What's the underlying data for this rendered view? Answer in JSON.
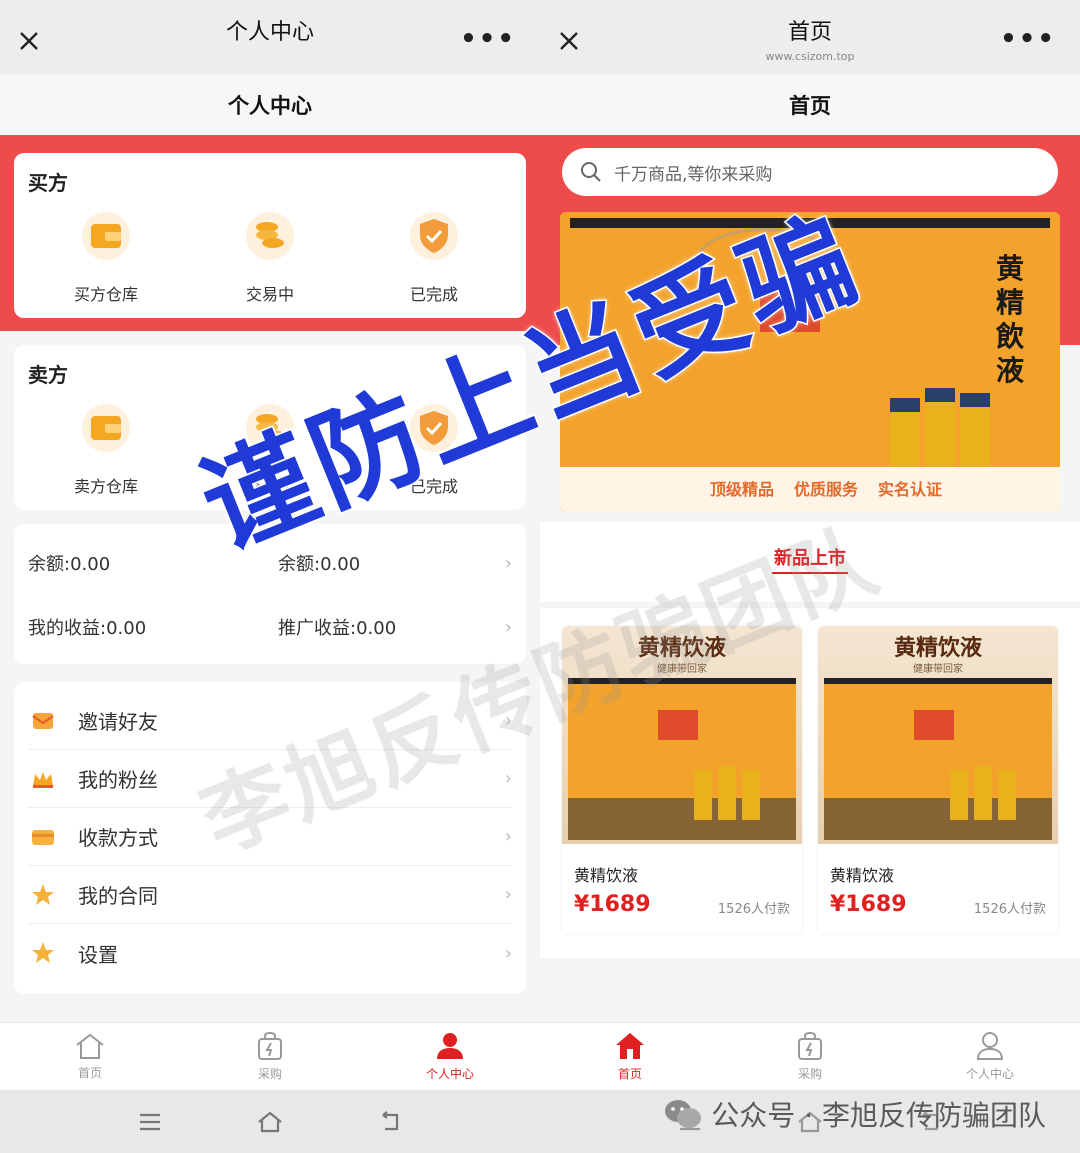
{
  "left": {
    "window_title": "个人中心",
    "page_title": "个人中心",
    "buyer": {
      "title": "买方",
      "items": [
        {
          "label": "买方仓库",
          "icon": "wallet-icon"
        },
        {
          "label": "交易中",
          "icon": "coins-icon"
        },
        {
          "label": "已完成",
          "icon": "shield-check-icon"
        }
      ]
    },
    "seller": {
      "title": "卖方",
      "items": [
        {
          "label": "卖方仓库",
          "icon": "wallet-icon"
        },
        {
          "label": "交易中",
          "icon": "coins-icon"
        },
        {
          "label": "已完成",
          "icon": "shield-check-icon"
        }
      ]
    },
    "balance": {
      "balance_label": "余额:0.00",
      "balance_right": "余额:0.00",
      "earnings_label": "我的收益:0.00",
      "earnings_right": "推广收益:0.00"
    },
    "menu": [
      {
        "label": "邀请好友",
        "icon": "envelope-icon"
      },
      {
        "label": "我的粉丝",
        "icon": "crown-icon"
      },
      {
        "label": "收款方式",
        "icon": "card-icon"
      },
      {
        "label": "我的合同",
        "icon": "star-icon"
      },
      {
        "label": "设置",
        "icon": "star-icon"
      }
    ],
    "tabs": [
      {
        "label": "首页",
        "icon": "home-icon",
        "active": false
      },
      {
        "label": "采购",
        "icon": "bag-icon",
        "active": false
      },
      {
        "label": "个人中心",
        "icon": "person-icon",
        "active": true
      }
    ]
  },
  "right": {
    "window_title": "首页",
    "window_subtitle": "www.csizom.top",
    "page_title": "首页",
    "search_placeholder": "千万商品,等你来采购",
    "banner": {
      "vertical_text": "黄精飲液",
      "badges": [
        "顶级精品",
        "优质服务",
        "实名认证"
      ]
    },
    "section_title": "新品上市",
    "products": [
      {
        "header": "黄精饮液",
        "tagline": "健康带回家",
        "name": "黄精饮液",
        "price": "¥1689",
        "sold": "1526人付款"
      },
      {
        "header": "黄精饮液",
        "tagline": "健康带回家",
        "name": "黄精饮液",
        "price": "¥1689",
        "sold": "1526人付款"
      }
    ],
    "tabs": [
      {
        "label": "首页",
        "icon": "home-icon",
        "active": true
      },
      {
        "label": "采购",
        "icon": "bag-icon",
        "active": false
      },
      {
        "label": "个人中心",
        "icon": "person-icon",
        "active": false
      }
    ]
  },
  "overlay": {
    "warning": "谨防上当受骗",
    "watermark": "李旭反传防骗团队",
    "credit": "公众号 · 李旭反传防骗团队"
  },
  "colors": {
    "accent": "#e02020",
    "band": "#ee4b4b",
    "warning": "#1f3ad6",
    "icon_orange": "#f5a623"
  }
}
